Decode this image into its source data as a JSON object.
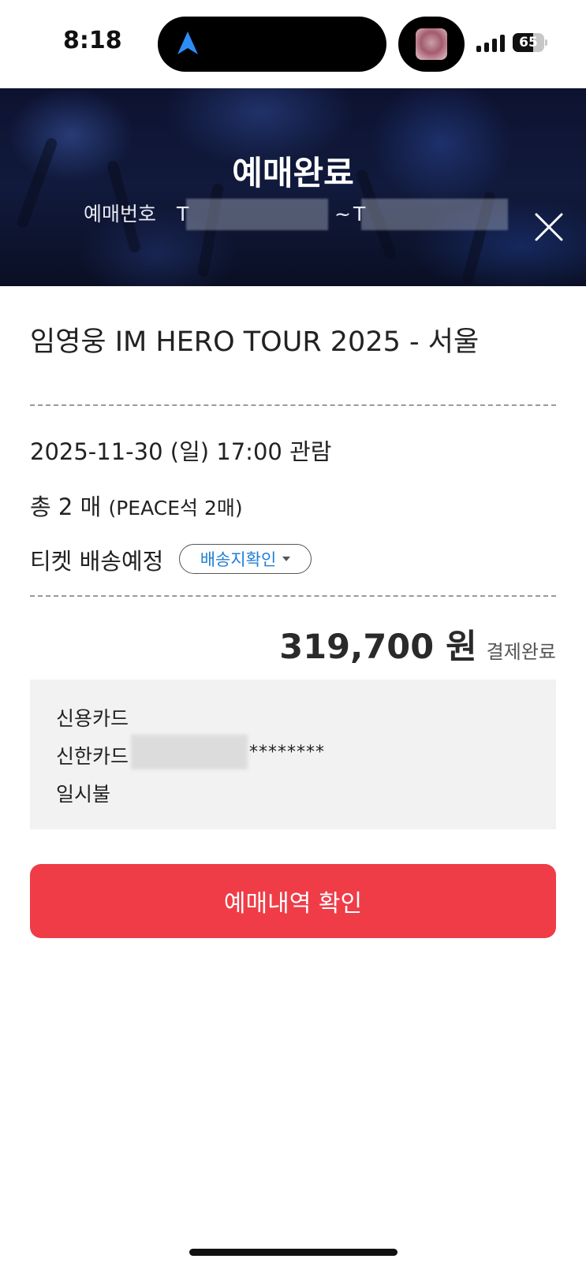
{
  "status_bar": {
    "time": "8:18",
    "battery_level": "65",
    "battery_fraction": 0.65
  },
  "header": {
    "title": "예매완료",
    "booking_number_label": "예매번호",
    "booking_number_start_prefix": "T",
    "booking_number_separator": "~",
    "booking_number_end_prefix": "T"
  },
  "concert": {
    "title": "임영웅 IM HERO TOUR 2025 - 서울"
  },
  "details": {
    "datetime": "2025-11-30 (일) 17:00 관람",
    "tickets_main": "총 2 매",
    "tickets_sub": "(PEACE석 2매)",
    "delivery_label": "티켓 배송예정",
    "delivery_button": "배송지확인"
  },
  "payment": {
    "amount": "319,700 원",
    "status": "결제완료",
    "method": "신용카드",
    "card_name": "신한카드",
    "card_masked": "********",
    "installment": "일시불"
  },
  "actions": {
    "confirm_button": "예매내역 확인"
  },
  "colors": {
    "accent_red": "#ef3c47",
    "link_blue": "#1f7fd6",
    "hero_bg": "#111a3c"
  }
}
